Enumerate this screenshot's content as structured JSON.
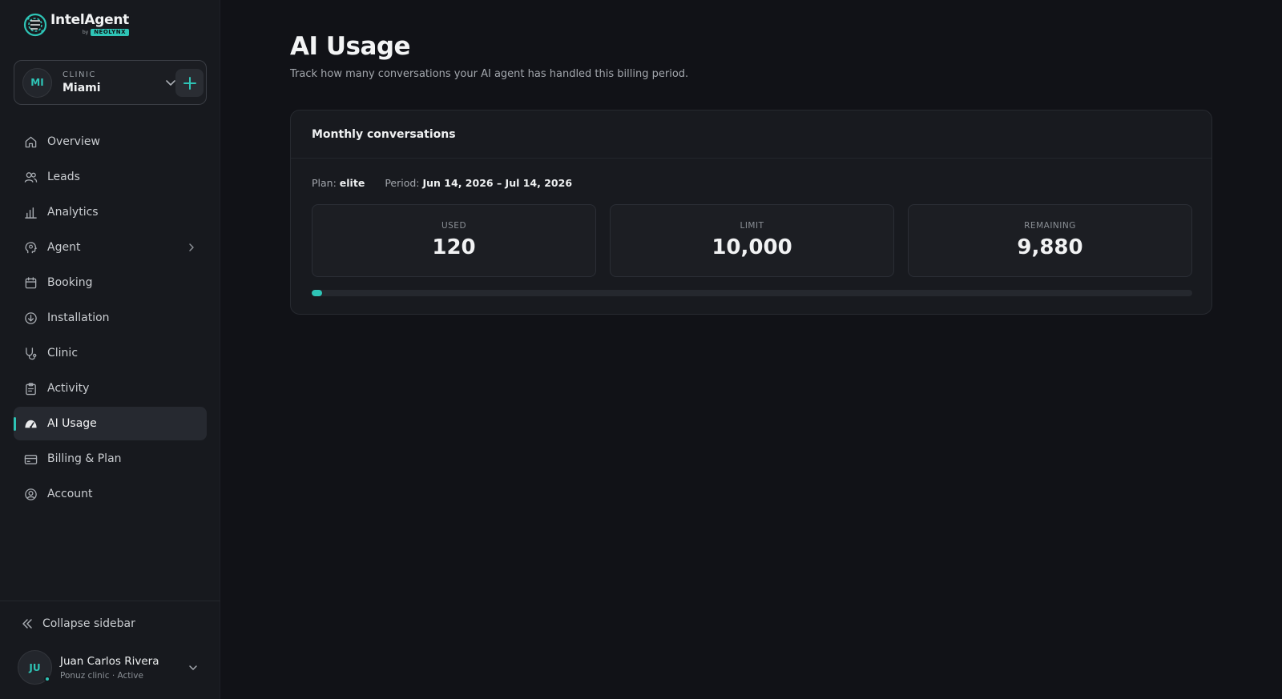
{
  "brand": {
    "name": "IntelAgent",
    "by": "by",
    "badge": "NEOLYNX"
  },
  "clinic_selector": {
    "initials": "MI",
    "kicker": "CLINIC",
    "name": "Miami"
  },
  "nav": {
    "items": [
      {
        "label": "Overview",
        "icon": "home-icon"
      },
      {
        "label": "Leads",
        "icon": "users-icon"
      },
      {
        "label": "Analytics",
        "icon": "bar-chart-icon"
      },
      {
        "label": "Agent",
        "icon": "brain-head-icon"
      },
      {
        "label": "Booking",
        "icon": "calendar-icon"
      },
      {
        "label": "Installation",
        "icon": "download-circle-icon"
      },
      {
        "label": "Clinic",
        "icon": "stethoscope-icon"
      },
      {
        "label": "Activity",
        "icon": "clipboard-icon"
      },
      {
        "label": "AI Usage",
        "icon": "gauge-icon",
        "active": true
      },
      {
        "label": "Billing & Plan",
        "icon": "credit-card-icon"
      },
      {
        "label": "Account",
        "icon": "user-circle-icon"
      }
    ]
  },
  "sidebar_footer": {
    "collapse_label": "Collapse sidebar",
    "user": {
      "initials": "JU",
      "name": "Juan Carlos Rivera",
      "meta": "Ponuz clinic · Active"
    }
  },
  "page": {
    "title": "AI Usage",
    "subtitle": "Track how many conversations your AI agent has handled this billing period."
  },
  "usage_card": {
    "title": "Monthly conversations",
    "plan_label": "Plan:",
    "plan_value": "elite",
    "period_label": "Period:",
    "period_value": "Jun 14, 2026 – Jul 14, 2026",
    "stats": [
      {
        "label": "USED",
        "value": "120"
      },
      {
        "label": "LIMIT",
        "value": "10,000"
      },
      {
        "label": "REMAINING",
        "value": "9,880"
      }
    ],
    "progress_fraction": 0.012
  },
  "colors": {
    "accent": "#2ec4b6",
    "background": "#111217",
    "sidebar": "#17191e",
    "card": "#181a1f"
  }
}
